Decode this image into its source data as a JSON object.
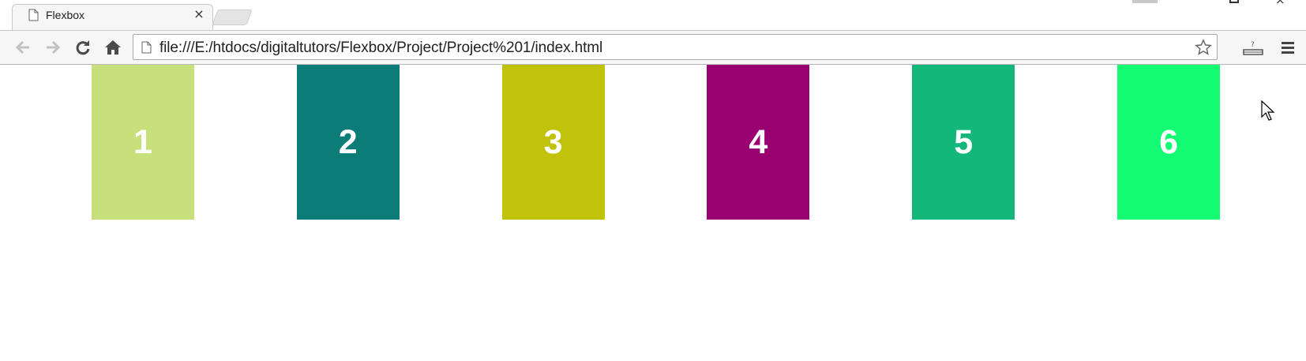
{
  "browser": {
    "tab": {
      "title": "Flexbox",
      "close_glyph": "×",
      "favicon": "page-icon"
    },
    "window_controls": {
      "close_glyph": "×"
    },
    "toolbar": {
      "back_icon": "back-arrow-icon",
      "forward_icon": "forward-arrow-icon",
      "reload_icon": "reload-icon",
      "home_icon": "home-icon",
      "url": "file:///E:/htdocs/digitaltutors/Flexbox/Project/Project%201/index.html",
      "bookmark_icon": "star-icon",
      "extension_icon": "extension-icon",
      "menu_icon": "hamburger-menu-icon"
    }
  },
  "page": {
    "boxes": [
      {
        "label": "1",
        "color": "#c7e07c"
      },
      {
        "label": "2",
        "color": "#0b7c78"
      },
      {
        "label": "3",
        "color": "#c1c20b"
      },
      {
        "label": "4",
        "color": "#990070"
      },
      {
        "label": "5",
        "color": "#13b77a"
      },
      {
        "label": "6",
        "color": "#14fc74"
      }
    ]
  }
}
